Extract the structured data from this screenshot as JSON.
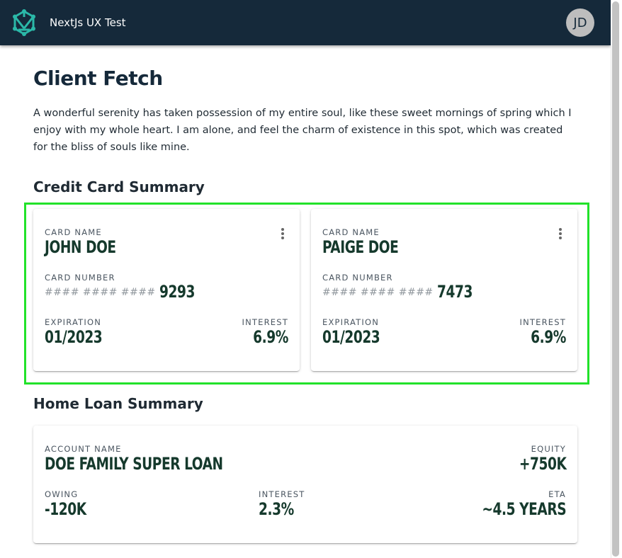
{
  "app": {
    "title": "NextJs UX Test",
    "avatar_initials": "JD",
    "colors": {
      "appbar": "#15293a",
      "highlight": "#22e22a",
      "value_text": "#15392c"
    }
  },
  "page": {
    "title": "Client Fetch",
    "intro": "A wonderful serenity has taken possession of my entire soul, like these sweet mornings of spring which I enjoy with my whole heart. I am alone, and feel the charm of existence in this spot, which was created for the bliss of souls like mine."
  },
  "credit": {
    "section_title": "Credit Card Summary",
    "cards": [
      {
        "name_label": "CARD NAME",
        "name": "JOHN DOE",
        "number_label": "CARD NUMBER",
        "masked": "#### #### ####",
        "last4": "9293",
        "exp_label": "EXPIRATION",
        "exp": "01/2023",
        "interest_label": "INTEREST",
        "interest": "6.9%",
        "menu_icon": "more-vert-icon"
      },
      {
        "name_label": "CARD NAME",
        "name": "PAIGE DOE",
        "number_label": "CARD NUMBER",
        "masked": "#### #### ####",
        "last4": "7473",
        "exp_label": "EXPIRATION",
        "exp": "01/2023",
        "interest_label": "INTEREST",
        "interest": "6.9%",
        "menu_icon": "more-vert-icon"
      }
    ]
  },
  "loan": {
    "section_title": "Home Loan Summary",
    "account_label": "ACCOUNT NAME",
    "account": "DOE FAMILY SUPER LOAN",
    "equity_label": "EQUITY",
    "equity": "+750K",
    "owing_label": "OWING",
    "owing": "-120K",
    "interest_label": "INTEREST",
    "interest": "2.3%",
    "eta_label": "ETA",
    "eta": "~4.5 YEARS"
  }
}
